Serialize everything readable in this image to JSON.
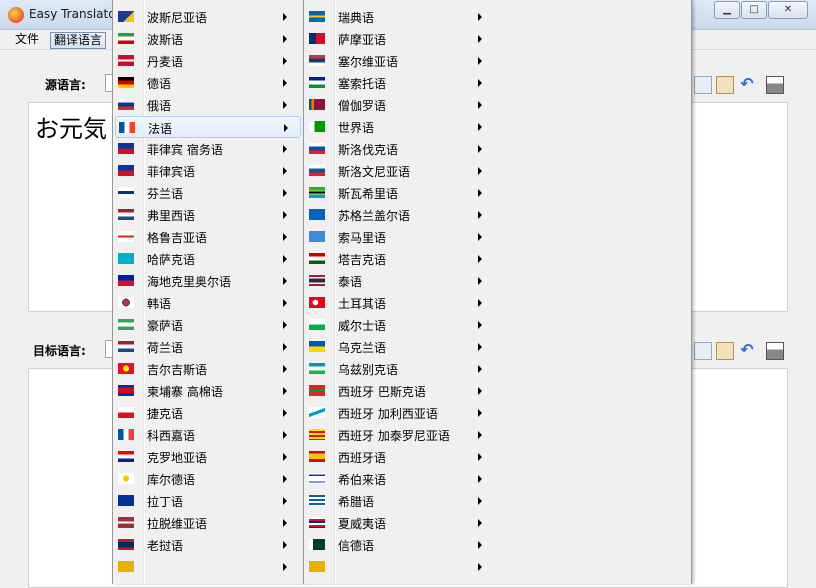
{
  "window": {
    "title": "Easy Translato"
  },
  "menubar": {
    "items": [
      {
        "label": "文件"
      },
      {
        "label": "翻译语言"
      }
    ]
  },
  "source": {
    "label": "源语言:",
    "text": "お元気"
  },
  "target": {
    "label": "目标语言:",
    "text": ""
  },
  "colors": {
    "highlight": "#e1ecfa",
    "menu_bg": "#f0f0f0",
    "border": "#979797"
  },
  "menu_left": [
    {
      "label": "",
      "flag": "top-partial"
    },
    {
      "label": "波斯尼亚语",
      "flag": "bosnia"
    },
    {
      "label": "波斯语",
      "flag": "iran"
    },
    {
      "label": "丹麦语",
      "flag": "denmark"
    },
    {
      "label": "德语",
      "flag": "germany"
    },
    {
      "label": "俄语",
      "flag": "russia"
    },
    {
      "label": "法语",
      "flag": "france",
      "highlighted": true
    },
    {
      "label": "菲律宾 宿务语",
      "flag": "philippines"
    },
    {
      "label": "菲律宾语",
      "flag": "philippines"
    },
    {
      "label": "芬兰语",
      "flag": "finland"
    },
    {
      "label": "弗里西语",
      "flag": "netherlands"
    },
    {
      "label": "格鲁吉亚语",
      "flag": "georgia"
    },
    {
      "label": "哈萨克语",
      "flag": "kazakhstan"
    },
    {
      "label": "海地克里奥尔语",
      "flag": "haiti"
    },
    {
      "label": "韩语",
      "flag": "korea"
    },
    {
      "label": "豪萨语",
      "flag": "nigeria"
    },
    {
      "label": "荷兰语",
      "flag": "netherlands"
    },
    {
      "label": "吉尔吉斯语",
      "flag": "kyrgyzstan"
    },
    {
      "label": "柬埔寨 高棉语",
      "flag": "cambodia"
    },
    {
      "label": "捷克语",
      "flag": "czech"
    },
    {
      "label": "科西嘉语",
      "flag": "france"
    },
    {
      "label": "克罗地亚语",
      "flag": "croatia"
    },
    {
      "label": "库尔德语",
      "flag": "kurdistan"
    },
    {
      "label": "拉丁语",
      "flag": "eu"
    },
    {
      "label": "拉脱维亚语",
      "flag": "latvia"
    },
    {
      "label": "老挝语",
      "flag": "laos"
    },
    {
      "label": "",
      "flag": "bottom-partial"
    }
  ],
  "menu_right": [
    {
      "label": "",
      "flag": "top-partial"
    },
    {
      "label": "瑞典语",
      "flag": "sweden"
    },
    {
      "label": "萨摩亚语",
      "flag": "samoa"
    },
    {
      "label": "塞尔维亚语",
      "flag": "serbia"
    },
    {
      "label": "塞索托语",
      "flag": "lesotho"
    },
    {
      "label": "僧伽罗语",
      "flag": "srilanka"
    },
    {
      "label": "世界语",
      "flag": "esperanto"
    },
    {
      "label": "斯洛伐克语",
      "flag": "slovakia"
    },
    {
      "label": "斯洛文尼亚语",
      "flag": "slovenia"
    },
    {
      "label": "斯瓦希里语",
      "flag": "tanzania"
    },
    {
      "label": "苏格兰盖尔语",
      "flag": "scotland"
    },
    {
      "label": "索马里语",
      "flag": "somalia"
    },
    {
      "label": "塔吉克语",
      "flag": "tajikistan"
    },
    {
      "label": "泰语",
      "flag": "thailand"
    },
    {
      "label": "土耳其语",
      "flag": "turkey"
    },
    {
      "label": "威尔士语",
      "flag": "wales"
    },
    {
      "label": "乌克兰语",
      "flag": "ukraine"
    },
    {
      "label": "乌兹别克语",
      "flag": "uzbekistan"
    },
    {
      "label": "西班牙 巴斯克语",
      "flag": "basque"
    },
    {
      "label": "西班牙 加利西亚语",
      "flag": "galicia"
    },
    {
      "label": "西班牙 加泰罗尼亚语",
      "flag": "catalonia"
    },
    {
      "label": "西班牙语",
      "flag": "spain"
    },
    {
      "label": "希伯来语",
      "flag": "israel"
    },
    {
      "label": "希腊语",
      "flag": "greece"
    },
    {
      "label": "夏威夷语",
      "flag": "hawaii"
    },
    {
      "label": "信德语",
      "flag": "pakistan"
    },
    {
      "label": "",
      "flag": "bottom-partial"
    }
  ]
}
